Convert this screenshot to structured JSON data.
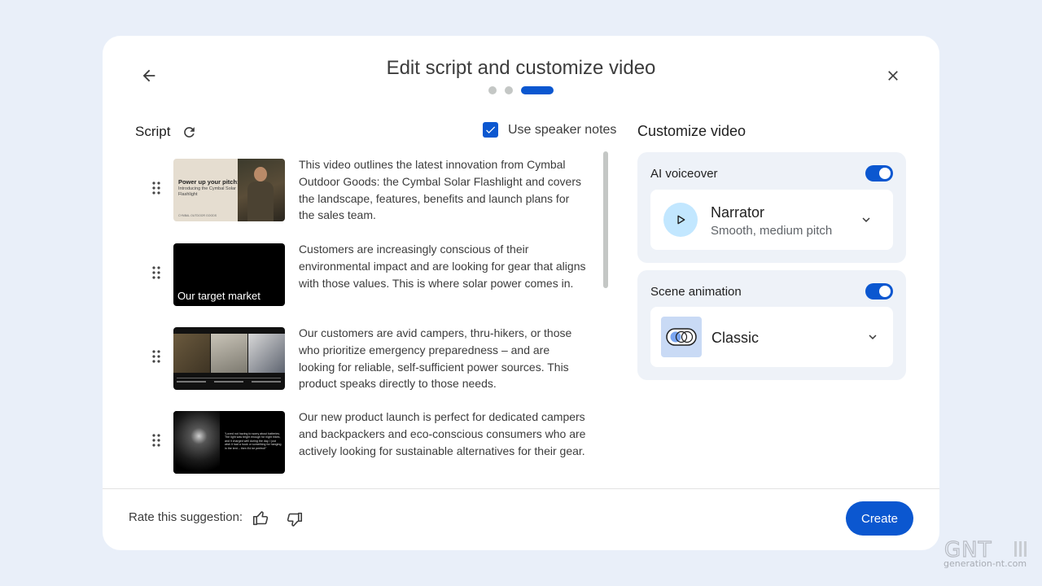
{
  "dialog": {
    "title": "Edit script and customize video",
    "steps": {
      "total": 3,
      "current": 3
    }
  },
  "script": {
    "label": "Script",
    "use_speaker_notes": {
      "label": "Use speaker notes",
      "checked": true
    },
    "scenes": [
      {
        "thumb_title": "Power up your pitch:",
        "thumb_subtitle": "Introducing the Cymbal Solar Flashlight",
        "thumb_footer": "CYMBAL OUTDOOR GOODS",
        "text": "This video outlines the latest innovation from Cymbal Outdoor Goods: the Cymbal Solar Flashlight and covers the landscape, features, benefits and launch plans for the sales team."
      },
      {
        "thumb_title": "Our target market",
        "text": "Customers are increasingly conscious of their environmental impact and are looking for gear that aligns with those values. This is where solar power comes in."
      },
      {
        "text": "Our customers are avid campers, thru-hikers, or those who prioritize emergency preparedness – and are looking for reliable, self-sufficient power sources. This product speaks directly to those needs."
      },
      {
        "thumb_quote": "“Loved not having to worry about batteries. The light was bright enough for night hikes, and it charged well during the day. I just wish it had a hook or something for hanging in the tent – then it'd be perfect!”",
        "text": "Our new product launch is perfect for dedicated campers and backpackers and eco-conscious consumers who are actively looking for sustainable alternatives for their gear."
      }
    ]
  },
  "customize": {
    "title": "Customize video",
    "voiceover": {
      "label": "AI voiceover",
      "enabled": true,
      "voice_name": "Narrator",
      "voice_desc": "Smooth, medium pitch",
      "icon": "play-icon"
    },
    "animation": {
      "label": "Scene animation",
      "enabled": true,
      "style": "Classic",
      "icon": "animation-style-icon"
    }
  },
  "footer": {
    "rate_label": "Rate this suggestion:",
    "create_label": "Create"
  },
  "colors": {
    "accent": "#0b57d0",
    "panel": "#eef2f8",
    "background": "#e9eff9"
  }
}
